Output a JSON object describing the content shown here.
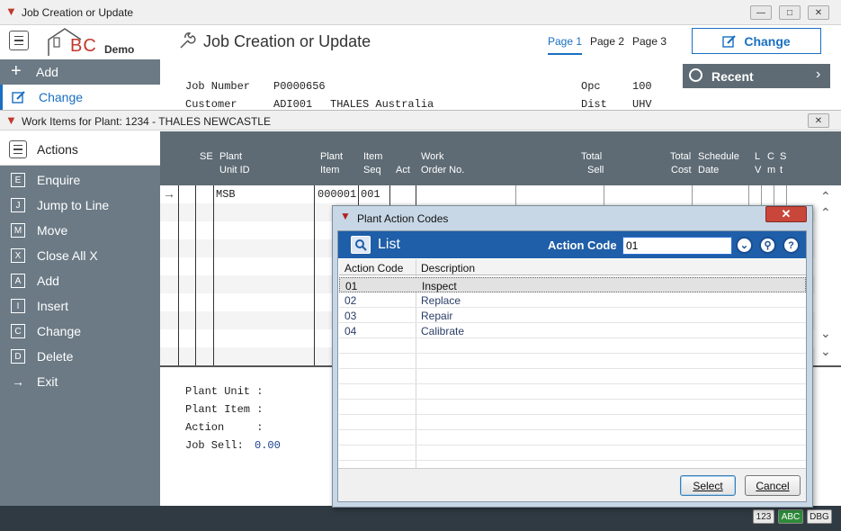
{
  "outer_window": {
    "title": "Job Creation or Update"
  },
  "header": {
    "logo_text": "BC",
    "logo_sub": "Demo",
    "page_title": "Job Creation or Update",
    "tabs": [
      "Page 1",
      "Page 2",
      "Page 3"
    ],
    "change_button": "Change"
  },
  "outer_sidebar": {
    "items": [
      "Add",
      "Change"
    ]
  },
  "recent": {
    "label": "Recent"
  },
  "job": {
    "job_number_label": "Job Number",
    "job_number": "P0000656",
    "customer_label": "Customer",
    "customer_code": "ADI001",
    "customer_name": "THALES Australia",
    "opc_label": "Opc",
    "opc": "100",
    "dist_label": "Dist",
    "dist": "UHV"
  },
  "inner_window": {
    "title": "Work Items for Plant: 1234  - THALES NEWCASTLE"
  },
  "actions": {
    "title": "Actions",
    "items": [
      {
        "key": "E",
        "label": "Enquire"
      },
      {
        "key": "J",
        "label": "Jump to Line"
      },
      {
        "key": "M",
        "label": "Move"
      },
      {
        "key": "X",
        "label": "Close All X"
      },
      {
        "key": "A",
        "label": "Add"
      },
      {
        "key": "I",
        "label": "Insert"
      },
      {
        "key": "C",
        "label": "Change"
      },
      {
        "key": "D",
        "label": "Delete"
      },
      {
        "key": "→",
        "label": "Exit"
      }
    ]
  },
  "grid": {
    "headers": {
      "se": "SE",
      "plant_unit_id_1": "Plant",
      "plant_unit_id_2": "Unit ID",
      "plant_item_1": "Plant",
      "plant_item_2": "Item",
      "item_seq_1": "Item",
      "item_seq_2": "Seq",
      "act": "Act",
      "work_order_1": "Work",
      "work_order_2": "Order No.",
      "total_sell_1": "Total",
      "total_sell_2": "Sell",
      "total_cost_1": "Total",
      "total_cost_2": "Cost",
      "schedule_1": "Schedule",
      "schedule_2": "Date",
      "l": "L",
      "v": "V",
      "c": "C",
      "m": "m",
      "s": "S",
      "t": "t"
    },
    "row1": {
      "unit_id": "MSB",
      "item": "000001",
      "seq": "001"
    }
  },
  "details": {
    "plant_unit": "Plant Unit :",
    "plant_item": "Plant Item :",
    "action": "Action     :",
    "job_sell_label": "Job Sell:",
    "job_sell": "0.00"
  },
  "status": {
    "badges": [
      "123",
      "ABC",
      "DBG"
    ]
  },
  "dialog": {
    "title": "Plant Action Codes",
    "list_label": "List",
    "action_code_label": "Action Code",
    "action_code_value": "01",
    "columns": [
      "Action Code",
      "Description"
    ],
    "rows": [
      {
        "code": "01",
        "desc": "Inspect"
      },
      {
        "code": "02",
        "desc": "Replace"
      },
      {
        "code": "03",
        "desc": "Repair"
      },
      {
        "code": "04",
        "desc": "Calibrate"
      }
    ],
    "select_button": "Select",
    "cancel_button": "Cancel"
  },
  "colors": {
    "accent": "#1a6fc2",
    "sidebar": "#6b7a85",
    "grid_header": "#5e6b74",
    "dialog_band": "#1f5ea8"
  }
}
